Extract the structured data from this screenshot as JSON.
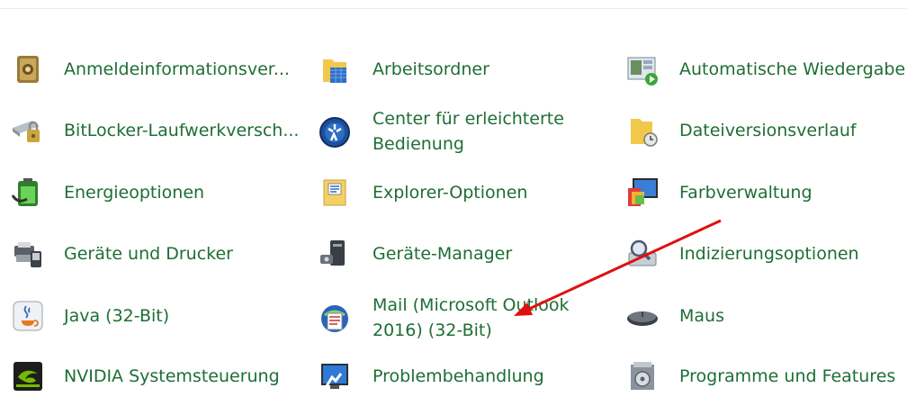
{
  "items": [
    {
      "label": "Anmeldeinformationsver...",
      "icon": "credential-manager-icon"
    },
    {
      "label": "Arbeitsordner",
      "icon": "work-folders-icon"
    },
    {
      "label": "Automatische Wiedergabe",
      "icon": "autoplay-icon"
    },
    {
      "label": "BitLocker-Laufwerkversch...",
      "icon": "bitlocker-icon"
    },
    {
      "label_line1": "Center für erleichterte",
      "label_line2": "Bedienung",
      "icon": "ease-of-access-icon"
    },
    {
      "label": "Dateiversionsverlauf",
      "icon": "file-history-icon"
    },
    {
      "label": "Energieoptionen",
      "icon": "power-options-icon"
    },
    {
      "label": "Explorer-Optionen",
      "icon": "explorer-options-icon"
    },
    {
      "label": "Farbverwaltung",
      "icon": "color-management-icon"
    },
    {
      "label": "Geräte und Drucker",
      "icon": "devices-printers-icon"
    },
    {
      "label": "Geräte-Manager",
      "icon": "device-manager-icon"
    },
    {
      "label": "Indizierungsoptionen",
      "icon": "indexing-options-icon"
    },
    {
      "label": "Java (32-Bit)",
      "icon": "java-icon"
    },
    {
      "label_line1": "Mail (Microsoft Outlook",
      "label_line2": "2016) (32-Bit)",
      "icon": "mail-icon"
    },
    {
      "label": "Maus",
      "icon": "mouse-icon"
    },
    {
      "label": "NVIDIA Systemsteuerung",
      "icon": "nvidia-icon"
    },
    {
      "label": "Problembehandlung",
      "icon": "troubleshooting-icon"
    },
    {
      "label": "Programme und Features",
      "icon": "programs-features-icon"
    }
  ],
  "colors": {
    "link": "#1e6e34",
    "annotation_arrow": "#e01010"
  }
}
